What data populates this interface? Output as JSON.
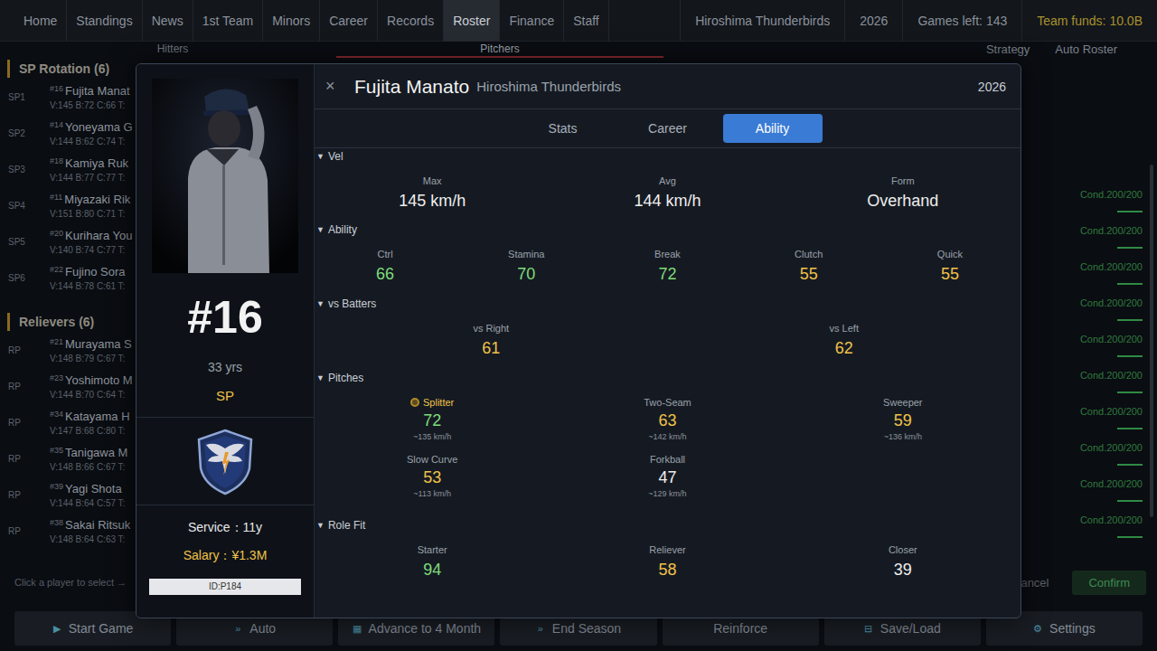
{
  "nav": {
    "tabs": [
      {
        "label": "Home",
        "selected": false
      },
      {
        "label": "Standings",
        "selected": false
      },
      {
        "label": "News",
        "selected": false
      },
      {
        "label": "1st Team",
        "selected": false
      },
      {
        "label": "Minors",
        "selected": false
      },
      {
        "label": "Career",
        "selected": false
      },
      {
        "label": "Records",
        "selected": false
      },
      {
        "label": "Roster",
        "selected": true
      },
      {
        "label": "Finance",
        "selected": false
      },
      {
        "label": "Staff",
        "selected": false
      }
    ],
    "info": [
      {
        "text": "Hiroshima Thunderbirds",
        "color": "#8a919b"
      },
      {
        "text": "2026",
        "color": "#8a919b"
      },
      {
        "text": "Games left: 143",
        "color": "#8a919b"
      },
      {
        "text": "Team funds: 10.0B",
        "color": "#a8912e"
      }
    ]
  },
  "subnav": {
    "tabs": [
      {
        "label": "Hitters",
        "selected": false
      },
      {
        "label": "Pitchers",
        "selected": true
      }
    ],
    "actions": [
      "Strategy",
      "Auto Roster"
    ]
  },
  "roster": {
    "groups": [
      {
        "title": "SP Rotation (6)",
        "rows": [
          {
            "slot": "SP1",
            "num": "#16",
            "name": "Fujita Manat",
            "stats": "V:145 B:72 C:66 T:"
          },
          {
            "slot": "SP2",
            "num": "#14",
            "name": "Yoneyama G",
            "stats": "V:144 B:62 C:74 T:"
          },
          {
            "slot": "SP3",
            "num": "#18",
            "name": "Kamiya Ruk",
            "stats": "V:144 B:77 C:77 T:"
          },
          {
            "slot": "SP4",
            "num": "#11",
            "name": "Miyazaki Rik",
            "stats": "V:151 B:80 C:71 T:"
          },
          {
            "slot": "SP5",
            "num": "#20",
            "name": "Kurihara You",
            "stats": "V:140 B:74 C:77 T:"
          },
          {
            "slot": "SP6",
            "num": "#22",
            "name": "Fujino Sora",
            "stats": "V:144 B:78 C:61 T:"
          }
        ]
      },
      {
        "title": "Relievers (6)",
        "rows": [
          {
            "slot": "RP",
            "num": "#21",
            "name": "Murayama S",
            "stats": "V:148 B:79 C:67 T:"
          },
          {
            "slot": "RP",
            "num": "#23",
            "name": "Yoshimoto M",
            "stats": "V:144 B:70 C:64 T:"
          },
          {
            "slot": "RP",
            "num": "#34",
            "name": "Katayama H",
            "stats": "V:147 B:68 C:80 T:"
          },
          {
            "slot": "RP",
            "num": "#35",
            "name": "Tanigawa M",
            "stats": "V:148 B:66 C:67 T:"
          },
          {
            "slot": "RP",
            "num": "#39",
            "name": "Yagi Shota",
            "stats": "V:144 B:64 C:57 T:"
          },
          {
            "slot": "RP",
            "num": "#38",
            "name": "Sakai Ritsuk",
            "stats": "V:148 B:64 C:63 T:"
          }
        ]
      }
    ],
    "conditions": [
      {
        "text": "Cond.200/200",
        "level": 1
      },
      {
        "text": "Cond.200/200",
        "level": 1
      },
      {
        "text": "Cond.200/200",
        "level": 1
      },
      {
        "text": "Cond.200/200",
        "level": 1
      },
      {
        "text": "Cond.200/200",
        "level": 1
      },
      {
        "text": "Cond.200/200",
        "level": 1
      },
      {
        "text": "Cond.200/200",
        "level": 1
      },
      {
        "text": "Cond.200/200",
        "level": 1
      },
      {
        "text": "Cond.200/200",
        "level": 1
      },
      {
        "text": "Cond.200/200",
        "level": 1
      }
    ],
    "hint": "Click a player to select →",
    "buttons": [
      "Cancel",
      "Confirm"
    ]
  },
  "modal": {
    "close": "×",
    "name": "Fujita Manato",
    "team": "Hiroshima Thunderbirds",
    "year": "2026",
    "number": "#16",
    "age": "33 yrs",
    "position": "SP",
    "service": "Service：11y",
    "salary": "Salary：¥1.3M",
    "id": "ID:P184",
    "tabs": [
      {
        "label": "Stats",
        "selected": false
      },
      {
        "label": "Career",
        "selected": false
      },
      {
        "label": "Ability",
        "selected": true
      }
    ],
    "sections": [
      {
        "toggle": "▼",
        "title": "Vel",
        "kind": "grid",
        "items": [
          {
            "label": "Max",
            "value": "145 km/h",
            "color": "#eeeeee"
          },
          {
            "label": "Avg",
            "value": "144 km/h",
            "color": "#eeeeee"
          },
          {
            "label": "Form",
            "value": "Overhand",
            "color": "#eeeeee"
          }
        ]
      },
      {
        "toggle": "▼",
        "title": "Ability",
        "kind": "grid",
        "items": [
          {
            "label": "Ctrl",
            "value": "66",
            "color": "#7fdc7a"
          },
          {
            "label": "Stamina",
            "value": "70",
            "color": "#7fdc7a"
          },
          {
            "label": "Break",
            "value": "72",
            "color": "#7fdc7a"
          },
          {
            "label": "Clutch",
            "value": "55",
            "color": "#f0c24a"
          },
          {
            "label": "Quick",
            "value": "55",
            "color": "#f0c24a"
          }
        ]
      },
      {
        "toggle": "▼",
        "title": "vs Batters",
        "kind": "grid",
        "items": [
          {
            "label": "vs Right",
            "value": "61",
            "color": "#f0c24a"
          },
          {
            "label": "vs Left",
            "value": "62",
            "color": "#f0c24a"
          }
        ]
      },
      {
        "toggle": "▼",
        "title": "Pitches",
        "kind": "pitches",
        "items": [
          {
            "label": "Splitter",
            "value": "72",
            "speed": "~135 km/h",
            "color": "#7fdc7a",
            "featured": true
          },
          {
            "label": "Two-Seam",
            "value": "63",
            "speed": "~142 km/h",
            "color": "#f0c24a",
            "featured": false
          },
          {
            "label": "Sweeper",
            "value": "59",
            "speed": "~136 km/h",
            "color": "#f0c24a",
            "featured": false
          },
          {
            "label": "Slow Curve",
            "value": "53",
            "speed": "~113 km/h",
            "color": "#f0c24a",
            "featured": false
          },
          {
            "label": "Forkball",
            "value": "47",
            "speed": "~129 km/h",
            "color": "#eeeeee",
            "featured": false
          }
        ]
      },
      {
        "toggle": "▼",
        "title": "Role Fit",
        "kind": "grid",
        "items": [
          {
            "label": "Starter",
            "value": "94",
            "color": "#7fdc7a"
          },
          {
            "label": "Reliever",
            "value": "58",
            "color": "#f0c24a"
          },
          {
            "label": "Closer",
            "value": "39",
            "color": "#eeeeee"
          }
        ]
      }
    ]
  },
  "bottom_bar": [
    {
      "icon": "▶",
      "label": "Start Game"
    },
    {
      "icon": "»",
      "label": "Auto"
    },
    {
      "icon": "▦",
      "label": "Advance to 4 Month"
    },
    {
      "icon": "»",
      "label": "End Season"
    },
    {
      "icon": "",
      "label": "Reinforce"
    },
    {
      "icon": "⊟",
      "label": "Save/Load"
    },
    {
      "icon": "⚙",
      "label": "Settings"
    }
  ]
}
